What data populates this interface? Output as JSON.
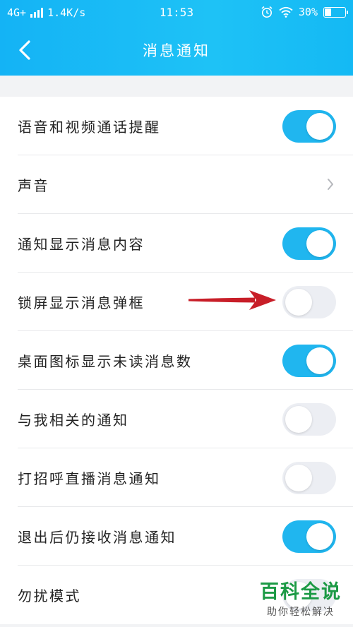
{
  "status_bar": {
    "network": "4G+",
    "speed": "1.4K/s",
    "time": "11:53",
    "battery": "30%",
    "battery_level": 0.3
  },
  "header": {
    "title": "消息通知",
    "back_icon": "chevron-left-icon",
    "color": "#1ab8f5"
  },
  "settings": [
    {
      "label": "语音和视频通话提醒",
      "control": "toggle",
      "on": true
    },
    {
      "label": "声音",
      "control": "chevron"
    },
    {
      "label": "通知显示消息内容",
      "control": "toggle",
      "on": true
    },
    {
      "label": "锁屏显示消息弹框",
      "control": "toggle",
      "on": false
    },
    {
      "label": "桌面图标显示未读消息数",
      "control": "toggle",
      "on": true
    },
    {
      "label": "与我相关的通知",
      "control": "toggle",
      "on": false
    },
    {
      "label": "打招呼直播消息通知",
      "control": "toggle",
      "on": false
    },
    {
      "label": "退出后仍接收消息通知",
      "control": "toggle",
      "on": true
    },
    {
      "label": "勿扰模式",
      "control": "toggle",
      "on": false
    }
  ],
  "accent_color": "#20b6ef",
  "annotation": {
    "icon": "red-arrow-icon",
    "color": "#c81e28"
  },
  "watermark": {
    "main": "百科全说",
    "sub": "助你轻松解决"
  }
}
